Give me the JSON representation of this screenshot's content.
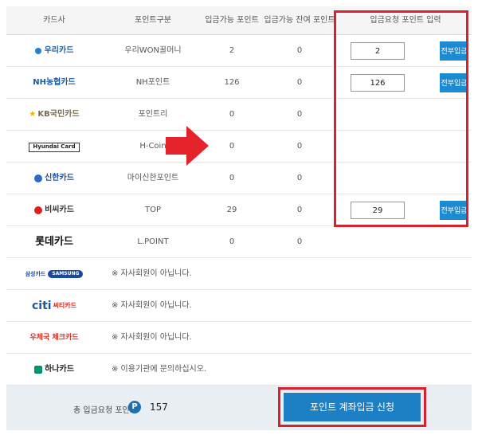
{
  "header": {
    "card_company": "카드사",
    "point_type": "포인트구분",
    "available_points": "입금가능 포인트",
    "remaining_points": "입금가능 잔여 포인트",
    "request_input": "입금요청 포인트 입력"
  },
  "rows": [
    {
      "logo": "우리카드",
      "type": "우리WON꿀머니",
      "avail": "2",
      "remaining": "0",
      "input": "2",
      "button": "전부입금"
    },
    {
      "logo": "NH농협카드",
      "type": "NH포인트",
      "avail": "126",
      "remaining": "0",
      "input": "126",
      "button": "전부입금"
    },
    {
      "logo": "KB국민카드",
      "type": "포인트리",
      "avail": "0",
      "remaining": "0"
    },
    {
      "logo": "Hyundai Card",
      "type": "H-Coin",
      "avail": "0",
      "remaining": "0"
    },
    {
      "logo": "신한카드",
      "type": "마이신한포인트",
      "avail": "0",
      "remaining": "0"
    },
    {
      "logo": "비씨카드",
      "type": "TOP",
      "avail": "29",
      "remaining": "0",
      "input": "29",
      "button": "전부입금"
    },
    {
      "logo": "롯데카드",
      "type": "L.POINT",
      "avail": "0",
      "remaining": "0"
    },
    {
      "logo_a": "삼성카드",
      "logo_b": "SAMSUNG",
      "notice": "※ 자사회원이 아닙니다."
    },
    {
      "logo_a": "citi",
      "logo_b": "씨티카드",
      "notice": "※ 자사회원이 아닙니다."
    },
    {
      "logo": "우체국 체크카드",
      "notice": "※ 자사회원이 아닙니다."
    },
    {
      "logo": "하나카드",
      "notice": "※ 이용기관에 문의하십시오."
    }
  ],
  "footer": {
    "total_label": "총 입금요청 포인트",
    "badge": "P",
    "total_value": "157",
    "submit_label": "포인트 계좌입금 신청"
  },
  "colors": {
    "accent_blue": "#1d8bd1",
    "highlight_red": "#d7212e",
    "footer_bg": "#e9eef3"
  }
}
